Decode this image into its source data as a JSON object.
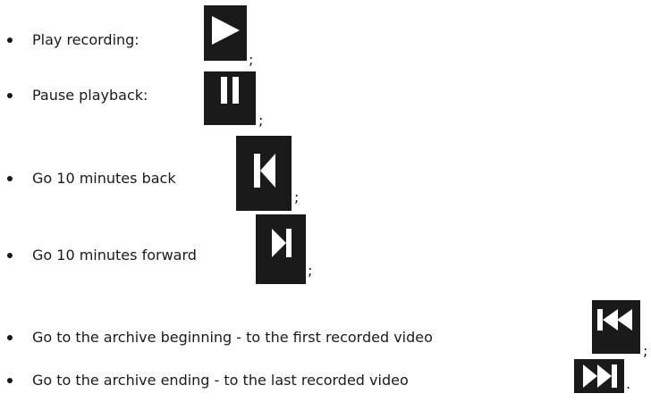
{
  "items": [
    {
      "label": "Play recording:",
      "icon": "play-icon",
      "suffix": ";"
    },
    {
      "label": "Pause playback:",
      "icon": "pause-icon",
      "suffix": ";"
    },
    {
      "label": "Go 10 minutes back",
      "icon": "step-back-icon",
      "suffix": ";"
    },
    {
      "label": "Go 10 minutes forward",
      "icon": "step-forward-icon",
      "suffix": ";"
    },
    {
      "label": "Go to the archive beginning - to the first recorded video",
      "icon": "skip-to-start-icon",
      "suffix": ";"
    },
    {
      "label": "Go to the archive ending - to the last recorded video",
      "icon": "skip-to-end-icon",
      "suffix": "."
    }
  ],
  "colors": {
    "icon_bg": "#1a1a1a",
    "icon_fg": "#ffffff",
    "text": "#1a1a1a"
  }
}
